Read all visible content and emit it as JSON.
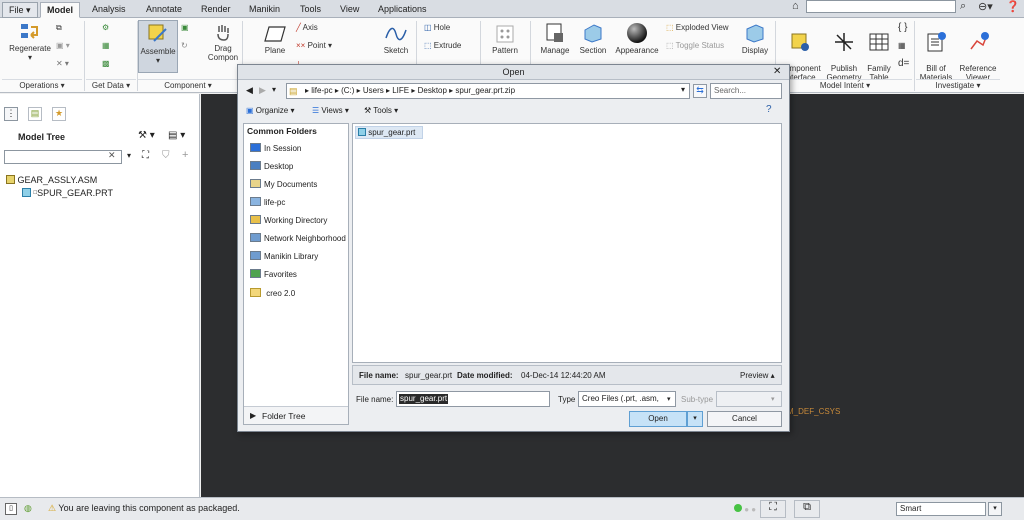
{
  "ribbon": {
    "tabs": [
      {
        "label": "File ▾",
        "state": "file"
      },
      {
        "label": "Model",
        "state": "active"
      },
      {
        "label": "Analysis",
        "state": ""
      },
      {
        "label": "Annotate",
        "state": ""
      },
      {
        "label": "Render",
        "state": ""
      },
      {
        "label": "Manikin",
        "state": ""
      },
      {
        "label": "Tools",
        "state": ""
      },
      {
        "label": "View",
        "state": ""
      },
      {
        "label": "Applications",
        "state": ""
      }
    ],
    "buttons": {
      "regenerate": "Regenerate",
      "assemble": "Assemble",
      "drag": "Drag",
      "drag_components": "Compon",
      "plane": "Plane",
      "axis": "Axis",
      "point": "Point ▾",
      "sketch": "Sketch",
      "hole": "Hole",
      "extrude": "Extrude",
      "pattern": "Pattern",
      "manage": "Manage",
      "section": "Section",
      "appearance": "Appearance",
      "exploded_view": "Exploded View",
      "toggle_status": "Toggle Status",
      "display": "Display",
      "component_interface": "Component\nInterface",
      "publish_geometry": "Publish\nGeometry",
      "family_table": "Family\nTable",
      "d_equals": "d=",
      "bill_of_materials": "Bill of\nMaterials",
      "reference_viewer": "Reference\nViewer"
    },
    "groups": {
      "operations": "Operations ▾",
      "get_data": "Get Data ▾",
      "component": "Component ▾",
      "model_intent": "Model Intent ▾",
      "investigate": "Investigate ▾"
    }
  },
  "model_tree": {
    "title": "Model Tree",
    "items": [
      "GEAR_ASSLY.ASM",
      "SPUR_GEAR.PRT"
    ]
  },
  "background_label": "M_DEF_CSYS",
  "status_bar": {
    "message": "You are leaving this component as packaged.",
    "filter": "Smart"
  },
  "dialog": {
    "title": "Open",
    "path": [
      "life-pc",
      "(C:)",
      "Users",
      "LIFE",
      "Desktop",
      "spur_gear.prt.zip"
    ],
    "search_placeholder": "Search...",
    "toolbar": {
      "organize": "Organize ▾",
      "views": "Views ▾",
      "tools": "Tools ▾"
    },
    "common_folders_title": "Common Folders",
    "folders": [
      "In Session",
      "Desktop",
      "My Documents",
      "life-pc",
      "Working Directory",
      "Network Neighborhood",
      "Manikin Library",
      "Favorites",
      "creo 2.0"
    ],
    "folder_tree": "Folder Tree",
    "files": [
      "spur_gear.prt"
    ],
    "details": {
      "file_name_label": "File name:",
      "file_name_value": "spur_gear.prt",
      "date_label": "Date modified:",
      "date_value": "04-Dec-14 12:44:20 AM",
      "preview": "Preview ▴"
    },
    "file_name_label": "File name:",
    "file_name_input": "spur_gear.prt",
    "type_label": "Type",
    "type_value": "Creo Files (.prt, .asm,",
    "subtype_label": "Sub-type",
    "open_button": "Open",
    "cancel_button": "Cancel"
  }
}
